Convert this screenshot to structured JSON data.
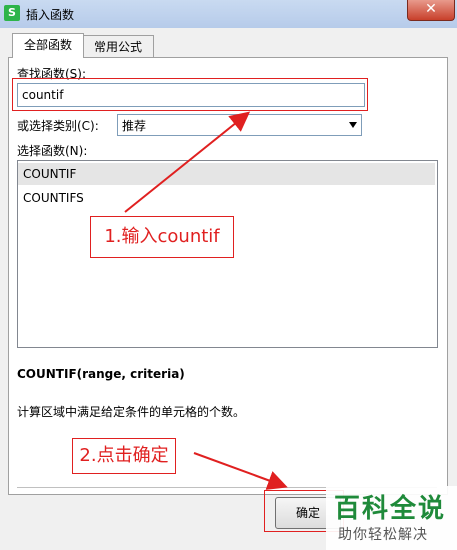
{
  "window": {
    "icon_letter": "S",
    "title": "插入函数",
    "close_glyph": "✕"
  },
  "tabs": [
    {
      "label": "全部函数",
      "active": true
    },
    {
      "label": "常用公式",
      "active": false
    }
  ],
  "search": {
    "label": "查找函数(S):",
    "value": "countif"
  },
  "category": {
    "label": "或选择类别(C):",
    "value": "推荐"
  },
  "functions": {
    "label": "选择函数(N):",
    "items": [
      "COUNTIF",
      "COUNTIFS"
    ]
  },
  "selected_function": {
    "signature": "COUNTIF(range, criteria)",
    "description": "计算区域中满足给定条件的单元格的个数。"
  },
  "buttons": {
    "ok": "确定"
  },
  "annotations": {
    "step1": "1.输入countif",
    "step2": "2.点击确定",
    "color": "#e02020"
  },
  "watermark": {
    "main": "百科全说",
    "sub": "助你轻松解决"
  }
}
